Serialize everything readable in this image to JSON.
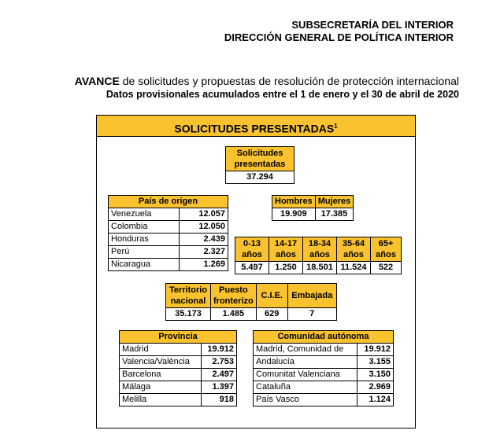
{
  "header": {
    "line1": "SUBSECRETARÍA DEL INTERIOR",
    "line2": "DIRECCIÓN GENERAL DE POLÍTICA INTERIOR"
  },
  "title": {
    "bold": "AVANCE",
    "rest": " de solicitudes y propuestas de resolución de protección internacional",
    "subtitle": "Datos provisionales acumulados entre el 1 de enero y el 30 de abril de 2020"
  },
  "section": {
    "title": "SOLICITUDES PRESENTADAS",
    "footnote": "1"
  },
  "total": {
    "label1": "Solicitudes",
    "label2": "presentadas",
    "value": "37.294"
  },
  "gender": {
    "men_label": "Hombres",
    "women_label": "Mujeres",
    "men": "19.909",
    "women": "17.385"
  },
  "origin": {
    "header": "País de origen",
    "rows": [
      {
        "name": "Venezuela",
        "value": "12.057"
      },
      {
        "name": "Colombia",
        "value": "12.050"
      },
      {
        "name": "Honduras",
        "value": "2.439"
      },
      {
        "name": "Perú",
        "value": "2.327"
      },
      {
        "name": "Nicaragua",
        "value": "1.269"
      }
    ]
  },
  "age": {
    "groups": [
      {
        "l1": "0-13",
        "l2": "años",
        "value": "5.497"
      },
      {
        "l1": "14-17",
        "l2": "años",
        "value": "1.250"
      },
      {
        "l1": "18-34",
        "l2": "años",
        "value": "18.501"
      },
      {
        "l1": "35-64",
        "l2": "años",
        "value": "11.524"
      },
      {
        "l1": "65+",
        "l2": "años",
        "value": "522"
      }
    ]
  },
  "place": {
    "cols": [
      {
        "l1": "Territorio",
        "l2": "nacional",
        "value": "35.173"
      },
      {
        "l1": "Puesto",
        "l2": "fronterizo",
        "value": "1.485"
      },
      {
        "l1": "C.I.E.",
        "l2": "",
        "value": "629"
      },
      {
        "l1": "Embajada",
        "l2": "",
        "value": "7"
      }
    ]
  },
  "province": {
    "header": "Provincia",
    "rows": [
      {
        "name": "Madrid",
        "value": "19.912"
      },
      {
        "name": "Valencia/València",
        "value": "2.753"
      },
      {
        "name": "Barcelona",
        "value": "2.497"
      },
      {
        "name": "Málaga",
        "value": "1.397"
      },
      {
        "name": "Melilla",
        "value": "918"
      }
    ]
  },
  "community": {
    "header": "Comunidad autónoma",
    "rows": [
      {
        "name": "Madrid, Comunidad de",
        "value": "19.912"
      },
      {
        "name": "Andalucía",
        "value": "3.155"
      },
      {
        "name": "Comunitat Valenciana",
        "value": "3.150"
      },
      {
        "name": "Cataluña",
        "value": "2.969"
      },
      {
        "name": "País Vasco",
        "value": "1.124"
      }
    ]
  }
}
